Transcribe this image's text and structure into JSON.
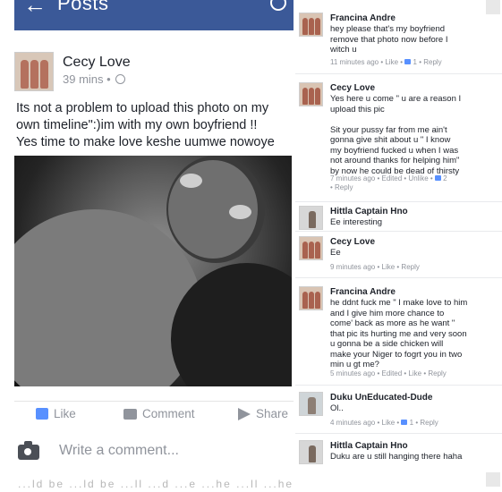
{
  "nav": {
    "title": "Posts"
  },
  "post": {
    "author": "Cecy Love",
    "time": "39 mins",
    "text": "Its not a problem to upload this photo on my own timeline\":)im  with my own boyfriend   !!\nYes time to make love keshe uumwe nowoye"
  },
  "actions": {
    "like": "Like",
    "comment": "Comment",
    "share": "Share"
  },
  "write_placeholder": "Write a comment...",
  "bottom_text": "...ld be ...ld be ...ll ...d ...e ...he ...ll ...he ...ld ...le",
  "comments": [
    {
      "name": "Francina Andre",
      "text": "hey please   that's my boyfriend\nremove that photo now    before I\nwitch u",
      "meta": "11 minutes ago  •  Like  •  ",
      "likes": "1",
      "meta_tail": "  •  Reply"
    },
    {
      "name": "Cecy Love",
      "text": "Yes here u come  \" u are a reason I\nupload this pic\n\n Sit your pussy far from me ain't\ngonna give shit   about   u \" I know\nmy boyfriend fucked u when I was\nnot around   thanks for helping him\"\nby now he could be dead of thirsty",
      "meta": "7 minutes ago  •  Edited  •  Unlike  •  ",
      "likes": "2",
      "meta_tail": "\n•  Reply"
    },
    {
      "name": "Hittla Captain Hno",
      "text": "Ee interesting",
      "meta": "",
      "likes": "",
      "meta_tail": ""
    },
    {
      "name": "Cecy Love",
      "text": "Ee",
      "meta": "9 minutes ago  •  Like  •  Reply",
      "likes": "",
      "meta_tail": ""
    },
    {
      "name": "Francina Andre",
      "text": "he ddnt fuck me \" I make love to him\nand I give him  more chance to\ncome' back as more as he want   \"\nthat pic its hurting me and very soon\nu gonna be a side chicken      will\nmake your Niger to fogrt you in two\nmin    u gt me?",
      "meta": "5 minutes ago  •  Edited  •  Like  •  Reply",
      "likes": "",
      "meta_tail": ""
    },
    {
      "name": "Duku UnEducated-Dude",
      "text": "Ol..",
      "meta": "4 minutes ago  •  Like  •  ",
      "likes": "1",
      "meta_tail": "  •  Reply"
    },
    {
      "name": "Hittla Captain Hno",
      "text": "Duku are u still hanging there haha",
      "meta": "",
      "likes": "",
      "meta_tail": ""
    }
  ]
}
